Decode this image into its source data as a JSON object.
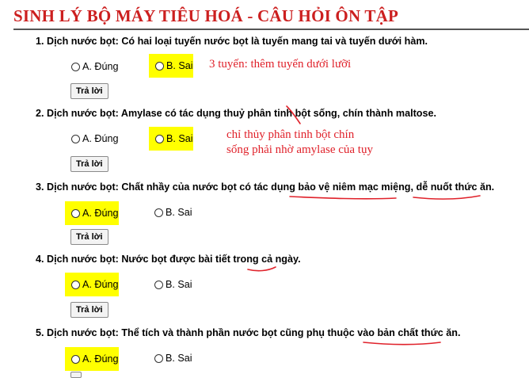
{
  "page": {
    "title": "SINH LÝ BỘ MÁY TIÊU HOÁ - CÂU HỎI ÔN TẬP"
  },
  "questions": [
    {
      "text": "1. Dịch nước bọt: Có hai loại tuyến nước bọt là tuyến mang tai và tuyến dưới hàm.",
      "option_a": "A. Đúng",
      "option_b": "B. Sai",
      "highlighted": "B",
      "button": "Trả lời",
      "note_lines": [
        "3 tuyến: thêm tuyến dưới lưỡi"
      ]
    },
    {
      "text": "2. Dịch nước bọt: Amylase có tác dụng thuỷ phân tinh bột sống, chín thành maltose.",
      "option_a": "A. Đúng",
      "option_b": "B. Sai",
      "highlighted": "B",
      "button": "Trả lời",
      "note_lines": [
        "chỉ thủy phân tinh bột chín",
        "sống phải nhờ amylase của tụy"
      ]
    },
    {
      "text": "3. Dịch nước bọt: Chất nhầy của nước bọt có tác dụng bảo vệ niêm mạc miệng, dễ nuốt thức ăn.",
      "option_a": "A. Đúng",
      "option_b": "B. Sai",
      "highlighted": "A",
      "button": "Trả lời"
    },
    {
      "text": "4. Dịch nước bọt: Nước bọt được bài tiết trong cả ngày.",
      "option_a": "A. Đúng",
      "option_b": "B. Sai",
      "highlighted": "A",
      "button": "Trả lời"
    },
    {
      "text": "5. Dịch nước bọt: Thể tích và thành phần nước bọt cũng phụ thuộc vào bản chất thức ăn.",
      "option_a": "A. Đúng",
      "option_b": "B. Sai",
      "highlighted": "A"
    }
  ],
  "colors": {
    "title": "#cc1f1f",
    "highlight": "#ffff00",
    "annotation": "#e0222b"
  }
}
